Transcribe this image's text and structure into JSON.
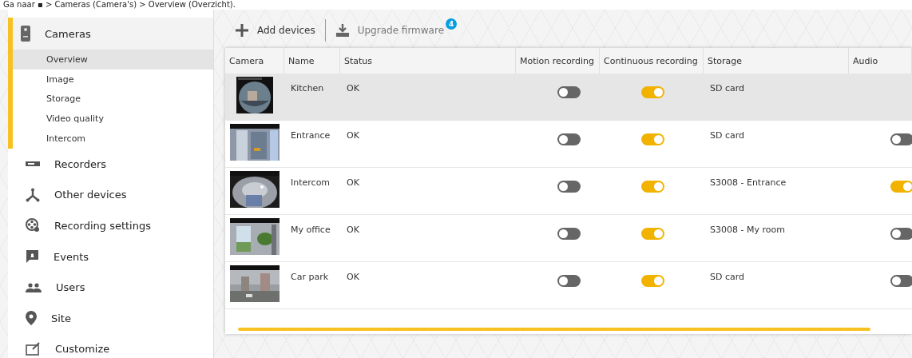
{
  "caption": "Ga naar ▪ > Cameras (Camera's) > Overview (Overzicht).",
  "sidebar": {
    "items": [
      {
        "label": "Cameras",
        "expanded": true,
        "children": [
          {
            "label": "Overview",
            "selected": true
          },
          {
            "label": "Image",
            "selected": false
          },
          {
            "label": "Storage",
            "selected": false
          },
          {
            "label": "Video quality",
            "selected": false
          },
          {
            "label": "Intercom",
            "selected": false
          }
        ]
      },
      {
        "label": "Recorders",
        "expanded": false
      },
      {
        "label": "Other devices",
        "expanded": false
      },
      {
        "label": "Recording settings",
        "expanded": false
      },
      {
        "label": "Events",
        "expanded": false
      },
      {
        "label": "Users",
        "expanded": false
      },
      {
        "label": "Site",
        "expanded": false
      },
      {
        "label": "Customize",
        "expanded": false
      }
    ]
  },
  "toolbar": {
    "add": "Add devices",
    "upgrade": "Upgrade firmware",
    "upgrade_badge": "4"
  },
  "table": {
    "columns": [
      "Camera",
      "Name",
      "Status",
      "Motion recording",
      "Continuous recording",
      "Storage",
      "Audio"
    ],
    "rows": [
      {
        "name": "Kitchen",
        "status": "OK",
        "motion": false,
        "continuous": true,
        "storage": "SD card",
        "selected": true
      },
      {
        "name": "Entrance",
        "status": "OK",
        "motion": false,
        "continuous": true,
        "storage": "SD card",
        "audio": false,
        "selected": false
      },
      {
        "name": "Intercom",
        "status": "OK",
        "motion": false,
        "continuous": true,
        "storage": "S3008 - Entrance",
        "audio": true,
        "selected": false
      },
      {
        "name": "My office",
        "status": "OK",
        "motion": false,
        "continuous": true,
        "storage": "S3008 - My room",
        "audio": false,
        "selected": false
      },
      {
        "name": "Car park",
        "status": "OK",
        "motion": false,
        "continuous": true,
        "storage": "SD card",
        "audio": false,
        "selected": false
      }
    ]
  }
}
